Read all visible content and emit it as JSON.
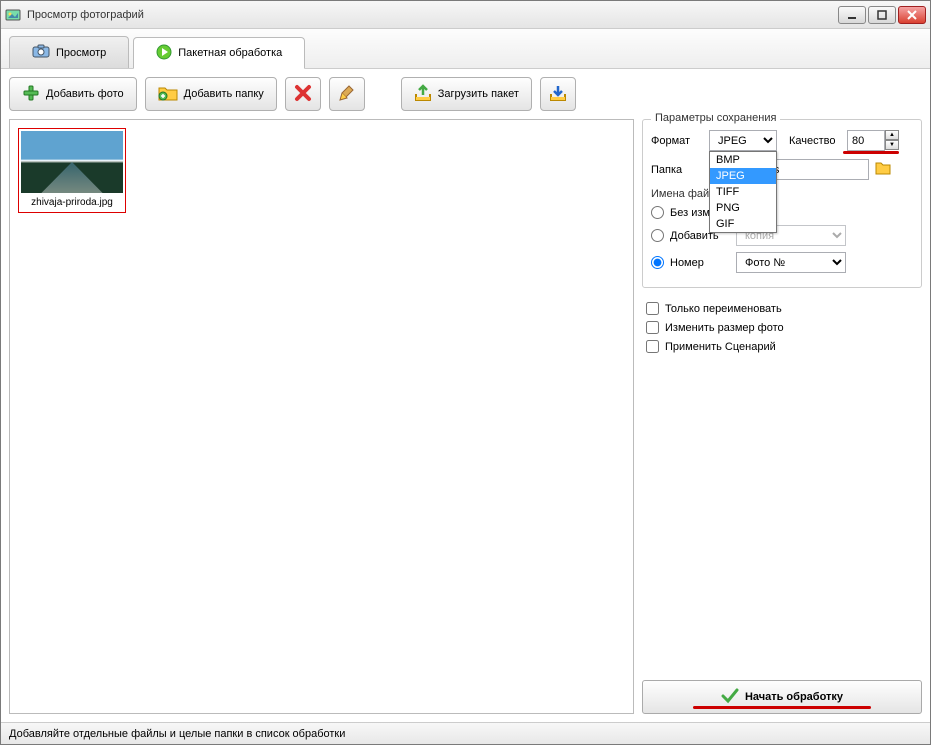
{
  "window": {
    "title": "Просмотр фотографий"
  },
  "tabs": {
    "view": "Просмотр",
    "batch": "Пакетная обработка"
  },
  "toolbar": {
    "add_photo": "Добавить фото",
    "add_folder": "Добавить папку",
    "load_batch": "Загрузить пакет"
  },
  "files": [
    {
      "name": "zhivaja-priroda.jpg"
    }
  ],
  "params": {
    "group_title": "Параметры сохранения",
    "format_label": "Формат",
    "format_value": "JPEG",
    "format_options": [
      "BMP",
      "JPEG",
      "TIFF",
      "PNG",
      "GIF"
    ],
    "quality_label": "Качество",
    "quality_value": "80",
    "folder_label": "Папка",
    "folder_value": "ublic\\Pictures",
    "names_title": "Имена файлов",
    "radio_nochange": "Без изменения",
    "radio_add": "Добавить",
    "add_value": "копия",
    "radio_number": "Номер",
    "number_value": "Фото №",
    "chk_rename": "Только переименовать",
    "chk_resize": "Изменить размер фото",
    "chk_scenario": "Применить Сценарий"
  },
  "start_btn": "Начать обработку",
  "status": "Добавляйте отдельные файлы и целые папки в список обработки"
}
